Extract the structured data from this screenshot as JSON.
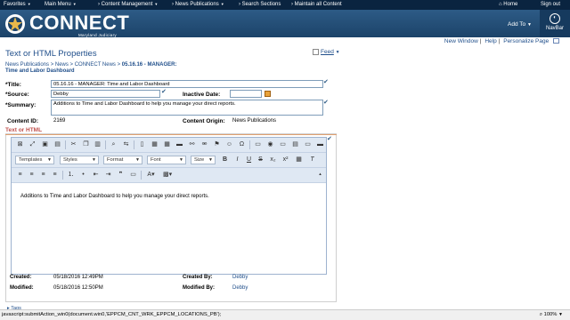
{
  "topbar": {
    "favorites": "Favorites",
    "main_menu": "Main Menu",
    "content_management": "Content Management",
    "news_publications": "News Publications",
    "search_sections": "Search Sections",
    "maintain_all": "Maintain all Content",
    "home": "Home",
    "sign_out": "Sign out"
  },
  "header": {
    "brand": "CONNECT",
    "sub": "Maryland Judiciary",
    "add_to": "Add To",
    "navbar": "NavBar"
  },
  "links": {
    "new_window": "New Window",
    "help": "Help",
    "personalize": "Personalize Page"
  },
  "page": {
    "title": "Text or HTML Properties",
    "feed": "Feed",
    "breadcrumb_a": "News Publications > News > CONNECT News > ",
    "breadcrumb_b": "05.16.16 - MANAGER: Time and Labor Dashboard"
  },
  "form": {
    "title_label": "Title:",
    "title_value": "05.16.16 - MANAGER: Time and Labor Dashboard",
    "source_label": "Source:",
    "source_value": "Debby",
    "inactive_label": "Inactive Date:",
    "inactive_value": "",
    "summary_label": "Summary:",
    "summary_value": "Additions to Time and Labor Dashboard to help you manage your direct reports.",
    "content_id_label": "Content ID:",
    "content_id_value": "2169",
    "origin_label": "Content Origin:",
    "origin_value": "News Publications"
  },
  "editor": {
    "section_title": "Text or HTML",
    "templates": "Templates",
    "styles": "Styles",
    "format": "Format",
    "font": "Font",
    "size": "Size",
    "body": "Additions to Time and Labor Dashboard to help you manage your direct reports."
  },
  "meta": {
    "created_label": "Created:",
    "created_value": "05/18/2016 12:49PM",
    "modified_label": "Modified:",
    "modified_value": "05/18/2016 12:50PM",
    "created_by_label": "Created By:",
    "created_by_value": "Debby",
    "modified_by_label": "Modified By:",
    "modified_by_value": "Debby",
    "tags": "Tags"
  },
  "status": {
    "text": "javascript:submitAction_win0(document.win0,'EPPCM_CNT_WRK_EPPCM_LOCATIONS_PB');",
    "zoom": "100%"
  }
}
